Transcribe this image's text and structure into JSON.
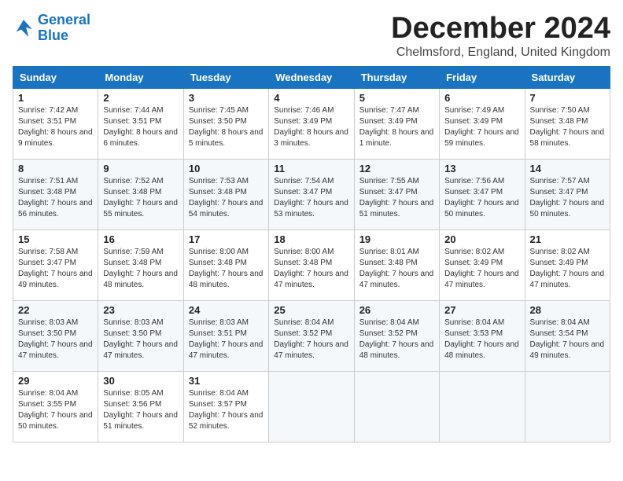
{
  "logo": {
    "line1": "General",
    "line2": "Blue"
  },
  "title": "December 2024",
  "subtitle": "Chelmsford, England, United Kingdom",
  "weekdays": [
    "Sunday",
    "Monday",
    "Tuesday",
    "Wednesday",
    "Thursday",
    "Friday",
    "Saturday"
  ],
  "weeks": [
    [
      {
        "day": "1",
        "sunrise": "7:42 AM",
        "sunset": "3:51 PM",
        "daylight": "8 hours and 9 minutes."
      },
      {
        "day": "2",
        "sunrise": "7:44 AM",
        "sunset": "3:51 PM",
        "daylight": "8 hours and 6 minutes."
      },
      {
        "day": "3",
        "sunrise": "7:45 AM",
        "sunset": "3:50 PM",
        "daylight": "8 hours and 5 minutes."
      },
      {
        "day": "4",
        "sunrise": "7:46 AM",
        "sunset": "3:49 PM",
        "daylight": "8 hours and 3 minutes."
      },
      {
        "day": "5",
        "sunrise": "7:47 AM",
        "sunset": "3:49 PM",
        "daylight": "8 hours and 1 minute."
      },
      {
        "day": "6",
        "sunrise": "7:49 AM",
        "sunset": "3:49 PM",
        "daylight": "7 hours and 59 minutes."
      },
      {
        "day": "7",
        "sunrise": "7:50 AM",
        "sunset": "3:48 PM",
        "daylight": "7 hours and 58 minutes."
      }
    ],
    [
      {
        "day": "8",
        "sunrise": "7:51 AM",
        "sunset": "3:48 PM",
        "daylight": "7 hours and 56 minutes."
      },
      {
        "day": "9",
        "sunrise": "7:52 AM",
        "sunset": "3:48 PM",
        "daylight": "7 hours and 55 minutes."
      },
      {
        "day": "10",
        "sunrise": "7:53 AM",
        "sunset": "3:48 PM",
        "daylight": "7 hours and 54 minutes."
      },
      {
        "day": "11",
        "sunrise": "7:54 AM",
        "sunset": "3:47 PM",
        "daylight": "7 hours and 53 minutes."
      },
      {
        "day": "12",
        "sunrise": "7:55 AM",
        "sunset": "3:47 PM",
        "daylight": "7 hours and 51 minutes."
      },
      {
        "day": "13",
        "sunrise": "7:56 AM",
        "sunset": "3:47 PM",
        "daylight": "7 hours and 50 minutes."
      },
      {
        "day": "14",
        "sunrise": "7:57 AM",
        "sunset": "3:47 PM",
        "daylight": "7 hours and 50 minutes."
      }
    ],
    [
      {
        "day": "15",
        "sunrise": "7:58 AM",
        "sunset": "3:47 PM",
        "daylight": "7 hours and 49 minutes."
      },
      {
        "day": "16",
        "sunrise": "7:59 AM",
        "sunset": "3:48 PM",
        "daylight": "7 hours and 48 minutes."
      },
      {
        "day": "17",
        "sunrise": "8:00 AM",
        "sunset": "3:48 PM",
        "daylight": "7 hours and 48 minutes."
      },
      {
        "day": "18",
        "sunrise": "8:00 AM",
        "sunset": "3:48 PM",
        "daylight": "7 hours and 47 minutes."
      },
      {
        "day": "19",
        "sunrise": "8:01 AM",
        "sunset": "3:48 PM",
        "daylight": "7 hours and 47 minutes."
      },
      {
        "day": "20",
        "sunrise": "8:02 AM",
        "sunset": "3:49 PM",
        "daylight": "7 hours and 47 minutes."
      },
      {
        "day": "21",
        "sunrise": "8:02 AM",
        "sunset": "3:49 PM",
        "daylight": "7 hours and 47 minutes."
      }
    ],
    [
      {
        "day": "22",
        "sunrise": "8:03 AM",
        "sunset": "3:50 PM",
        "daylight": "7 hours and 47 minutes."
      },
      {
        "day": "23",
        "sunrise": "8:03 AM",
        "sunset": "3:50 PM",
        "daylight": "7 hours and 47 minutes."
      },
      {
        "day": "24",
        "sunrise": "8:03 AM",
        "sunset": "3:51 PM",
        "daylight": "7 hours and 47 minutes."
      },
      {
        "day": "25",
        "sunrise": "8:04 AM",
        "sunset": "3:52 PM",
        "daylight": "7 hours and 47 minutes."
      },
      {
        "day": "26",
        "sunrise": "8:04 AM",
        "sunset": "3:52 PM",
        "daylight": "7 hours and 48 minutes."
      },
      {
        "day": "27",
        "sunrise": "8:04 AM",
        "sunset": "3:53 PM",
        "daylight": "7 hours and 48 minutes."
      },
      {
        "day": "28",
        "sunrise": "8:04 AM",
        "sunset": "3:54 PM",
        "daylight": "7 hours and 49 minutes."
      }
    ],
    [
      {
        "day": "29",
        "sunrise": "8:04 AM",
        "sunset": "3:55 PM",
        "daylight": "7 hours and 50 minutes."
      },
      {
        "day": "30",
        "sunrise": "8:05 AM",
        "sunset": "3:56 PM",
        "daylight": "7 hours and 51 minutes."
      },
      {
        "day": "31",
        "sunrise": "8:04 AM",
        "sunset": "3:57 PM",
        "daylight": "7 hours and 52 minutes."
      },
      null,
      null,
      null,
      null
    ]
  ]
}
